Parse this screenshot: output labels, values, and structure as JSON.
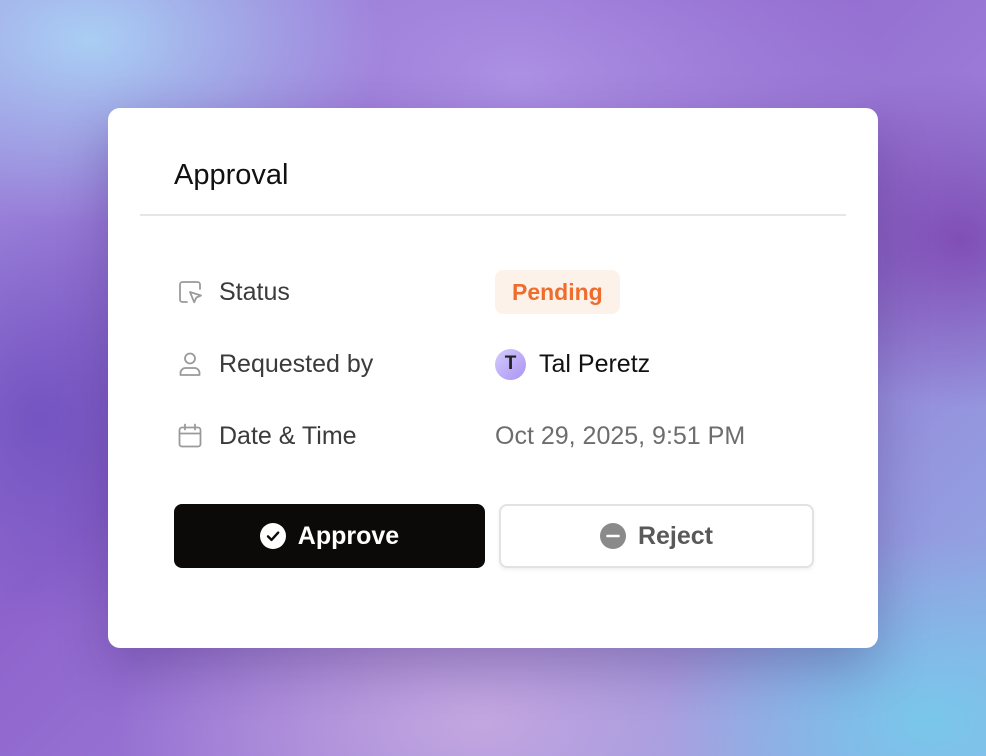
{
  "card": {
    "title": "Approval",
    "rows": [
      {
        "label": "Status",
        "icon": "cursor-square-icon",
        "value": "Pending"
      },
      {
        "label": "Requested by",
        "icon": "user-icon",
        "avatar_initial": "T",
        "value": "Tal Peretz"
      },
      {
        "label": "Date & Time",
        "icon": "calendar-icon",
        "value": "Oct 29, 2025, 9:51 PM"
      }
    ],
    "actions": {
      "approve_label": "Approve",
      "approve_icon": "check-circle-icon",
      "reject_label": "Reject",
      "reject_icon": "minus-circle-icon"
    }
  },
  "colors": {
    "pending_text": "#ee6d2c",
    "pending_bg": "#fdf2ea",
    "approve_bg": "#0c0a09",
    "reject_icon": "#8a8a8a"
  }
}
